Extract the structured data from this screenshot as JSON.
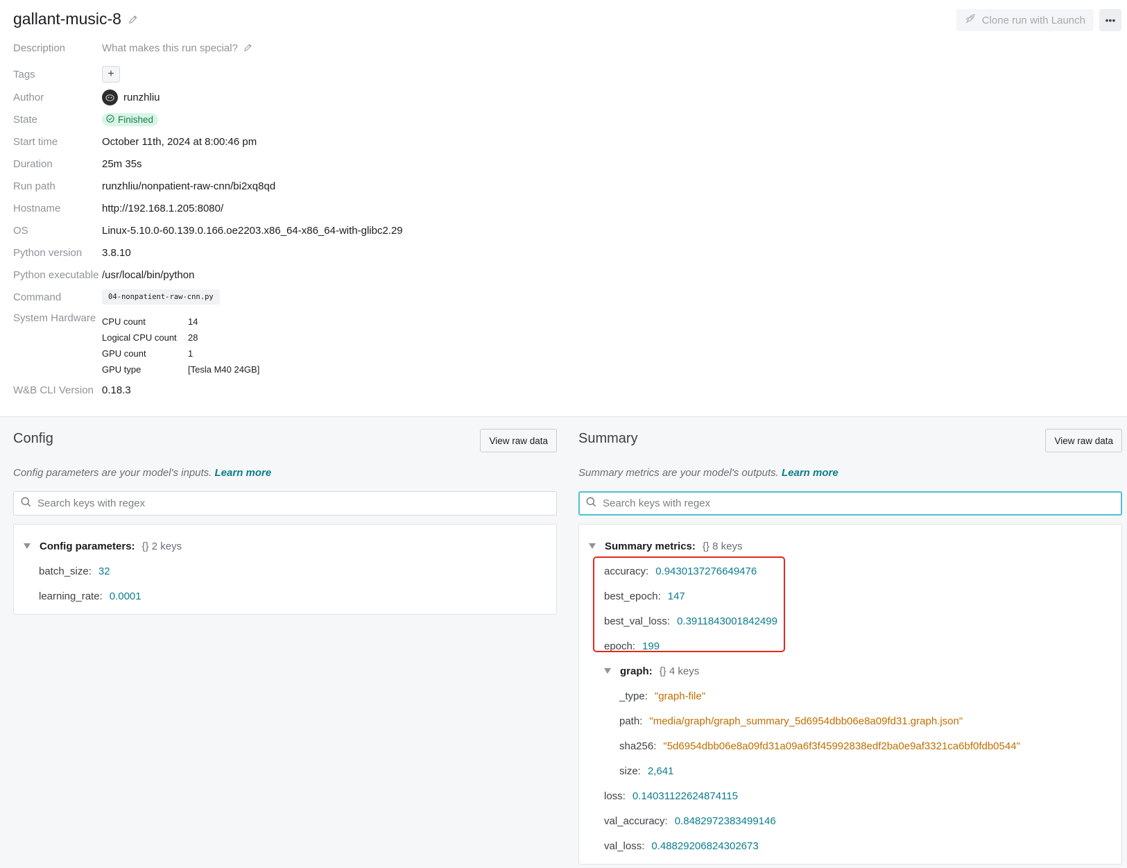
{
  "header": {
    "title": "gallant-music-8",
    "clone_label": "Clone run with Launch",
    "more_label": "•••"
  },
  "meta": {
    "description_label": "Description",
    "description_placeholder": "What makes this run special?",
    "tags_label": "Tags",
    "tags_add": "+",
    "author_label": "Author",
    "author": "runzhliu",
    "state_label": "State",
    "state": "Finished",
    "start_time_label": "Start time",
    "start_time": "October 11th, 2024 at 8:00:46 pm",
    "duration_label": "Duration",
    "duration": "25m 35s",
    "run_path_label": "Run path",
    "run_path": "runzhliu/nonpatient-raw-cnn/bi2xq8qd",
    "hostname_label": "Hostname",
    "hostname": "http://192.168.1.205:8080/",
    "os_label": "OS",
    "os": "Linux-5.10.0-60.139.0.166.oe2203.x86_64-x86_64-with-glibc2.29",
    "python_version_label": "Python version",
    "python_version": "3.8.10",
    "python_exec_label": "Python executable",
    "python_exec": "/usr/local/bin/python",
    "command_label": "Command",
    "command": "04-nonpatient-raw-cnn.py",
    "hardware_label": "System Hardware",
    "hardware": [
      {
        "key": "CPU count",
        "value": "14"
      },
      {
        "key": "Logical CPU count",
        "value": "28"
      },
      {
        "key": "GPU count",
        "value": "1"
      },
      {
        "key": "GPU type",
        "value": "[Tesla M40 24GB]"
      }
    ],
    "cli_label": "W&B CLI Version",
    "cli_version": "0.18.3"
  },
  "config": {
    "title": "Config",
    "raw_button": "View raw data",
    "desc": "Config parameters are your model's inputs.",
    "learn_more": "Learn more",
    "search_placeholder": "Search keys with regex",
    "root_label": "Config parameters:",
    "root_meta": "{}  2 keys",
    "items": [
      {
        "key": "batch_size:",
        "value": "32"
      },
      {
        "key": "learning_rate:",
        "value": "0.0001"
      }
    ]
  },
  "summary": {
    "title": "Summary",
    "raw_button": "View raw data",
    "desc": "Summary metrics are your model's outputs.",
    "learn_more": "Learn more",
    "search_placeholder": "Search keys with regex",
    "root_label": "Summary metrics:",
    "root_meta": "{}  8 keys",
    "items": [
      {
        "key": "accuracy:",
        "value": "0.9430137276649476"
      },
      {
        "key": "best_epoch:",
        "value": "147"
      },
      {
        "key": "best_val_loss:",
        "value": "0.3911843001842499"
      },
      {
        "key": "epoch:",
        "value": "199"
      }
    ],
    "graph_label": "graph:",
    "graph_meta": "{}  4 keys",
    "graph_items": [
      {
        "key": "_type:",
        "value": "\"graph-file\"",
        "kind": "str"
      },
      {
        "key": "path:",
        "value": "\"media/graph/graph_summary_5d6954dbb06e8a09fd31.graph.json\"",
        "kind": "str"
      },
      {
        "key": "sha256:",
        "value": "\"5d6954dbb06e8a09fd31a09a6f3f45992838edf2ba0e9af3321ca6bf0fdb0544\"",
        "kind": "str"
      },
      {
        "key": "size:",
        "value": "2,641",
        "kind": "num"
      }
    ],
    "tail_items": [
      {
        "key": "loss:",
        "value": "0.14031122624874115"
      },
      {
        "key": "val_accuracy:",
        "value": "0.8482972383499146"
      },
      {
        "key": "val_loss:",
        "value": "0.48829206824302673"
      }
    ]
  },
  "colors": {
    "accent": "#0b7d8c",
    "string_value": "#c06e00",
    "highlight": "#e5281a",
    "finished_bg": "#d8f5e6"
  }
}
